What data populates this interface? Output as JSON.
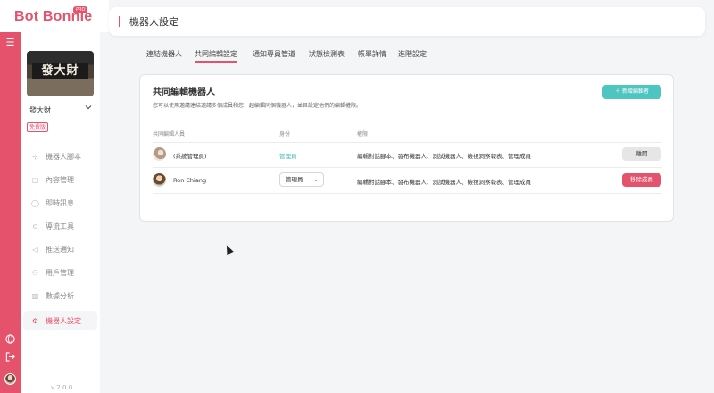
{
  "app": {
    "logo": "Bot Bonnie",
    "logo_badge": "PRO"
  },
  "rail": {
    "menu_icon": "menu-icon",
    "globe_icon": "globe-icon",
    "logout_icon": "logout-icon"
  },
  "sidebar": {
    "store_sign": "發大財",
    "store_name": "發大財",
    "plan": "免費版",
    "items": [
      {
        "label": "機器人腳本",
        "icon": "script-icon"
      },
      {
        "label": "內容管理",
        "icon": "content-icon"
      },
      {
        "label": "即時訊息",
        "icon": "chat-icon"
      },
      {
        "label": "導流工具",
        "icon": "magnet-icon"
      },
      {
        "label": "推送通知",
        "icon": "megaphone-icon"
      },
      {
        "label": "用戶管理",
        "icon": "users-icon"
      },
      {
        "label": "數據分析",
        "icon": "chart-icon"
      },
      {
        "label": "機器人設定",
        "icon": "gear-icon",
        "active": true
      }
    ],
    "version": "v 2.0.0"
  },
  "header": {
    "title": "機器人設定"
  },
  "tabs": [
    {
      "label": "連結機器人"
    },
    {
      "label": "共同編輯設定",
      "active": true
    },
    {
      "label": "通知專員管道"
    },
    {
      "label": "狀態檢測表"
    },
    {
      "label": "帳單詳情"
    },
    {
      "label": "進階設定"
    }
  ],
  "card": {
    "title": "共同編輯機器人",
    "description": "您可以使用邀請連結邀請多個成員和您一起編輯同個機器人，並且設定他們的編輯權限。",
    "add_button": "＋ 新增編輯者",
    "columns": {
      "member": "共同編輯人員",
      "role": "身份",
      "permission": "權限"
    },
    "rows": [
      {
        "name": "(系統管理員)",
        "role": "管理員",
        "permission": "編輯對話腳本、發布機器人、測試機器人、檢視洞察報表、管理成員",
        "action": "離開"
      },
      {
        "name": "Ron Chiang",
        "role": "管理員",
        "permission": "編輯對話腳本、發布機器人、測試機器人、檢視洞察報表、管理成員",
        "action": "移除成員"
      }
    ]
  },
  "colors": {
    "brand": "#e5526b",
    "teal": "#4ec5c1"
  }
}
